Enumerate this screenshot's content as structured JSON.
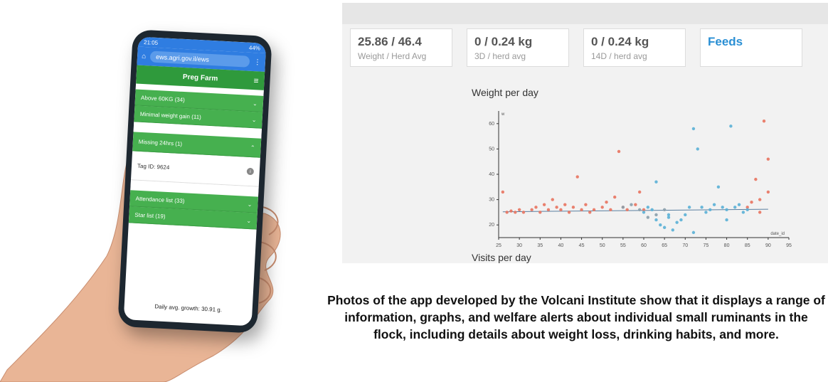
{
  "phone": {
    "status_time": "21:05",
    "status_right": "44%",
    "url": "ews.agri.gov.il/ews",
    "app_title": "Preg Farm",
    "sections": [
      {
        "label": "Above 60KG (34)"
      },
      {
        "label": "Minimal weight gain (11)"
      },
      {
        "label": "Missing 24hrs  (1)"
      },
      {
        "label": "Attendance list (33)"
      },
      {
        "label": "Star list  (19)"
      }
    ],
    "tag_id": "Tag ID: 9624",
    "footer": "Daily avg. growth: 30.91 g."
  },
  "dashboard": {
    "cards": [
      {
        "value": "25.86 / 46.4",
        "label": "Weight / Herd Avg"
      },
      {
        "value": "0 / 0.24 kg",
        "label": "3D / herd avg"
      },
      {
        "value": "0 / 0.24 kg",
        "label": "14D / herd avg"
      },
      {
        "value": "Feeds",
        "label": ""
      }
    ],
    "chart_title": "Weight per day",
    "visits_label": "Visits per day"
  },
  "chart_data": {
    "type": "scatter",
    "xlabel": "date_id",
    "ylabel": "w",
    "xlim": [
      25,
      95
    ],
    "ylim": [
      15,
      65
    ],
    "xticks": [
      25,
      30,
      35,
      40,
      45,
      50,
      55,
      60,
      65,
      70,
      75,
      80,
      85,
      90,
      95
    ],
    "yticks": [
      20,
      30,
      40,
      50,
      60
    ],
    "series": [
      {
        "color": "#e8735f",
        "points": [
          [
            26,
            33
          ],
          [
            27,
            25
          ],
          [
            28,
            25.5
          ],
          [
            29,
            25
          ],
          [
            30,
            26
          ],
          [
            31,
            25
          ],
          [
            33,
            26
          ],
          [
            34,
            27
          ],
          [
            35,
            25
          ],
          [
            36,
            28
          ],
          [
            37,
            26
          ],
          [
            38,
            30
          ],
          [
            39,
            27
          ],
          [
            40,
            26
          ],
          [
            41,
            28
          ],
          [
            42,
            25
          ],
          [
            43,
            27
          ],
          [
            44,
            39
          ],
          [
            45,
            26
          ],
          [
            46,
            28
          ],
          [
            47,
            25
          ],
          [
            48,
            26
          ],
          [
            50,
            27
          ],
          [
            51,
            29
          ],
          [
            52,
            26
          ],
          [
            53,
            31
          ],
          [
            54,
            49
          ],
          [
            55,
            27
          ],
          [
            56,
            26
          ],
          [
            58,
            28
          ],
          [
            59,
            33
          ],
          [
            60,
            26
          ],
          [
            85,
            27
          ],
          [
            86,
            29
          ],
          [
            87,
            38
          ],
          [
            88,
            30
          ],
          [
            89,
            61
          ],
          [
            90,
            46
          ],
          [
            90,
            33
          ],
          [
            88,
            25
          ]
        ]
      },
      {
        "color": "#5ab0d6",
        "points": [
          [
            60,
            25
          ],
          [
            61,
            27
          ],
          [
            62,
            26
          ],
          [
            63,
            22
          ],
          [
            64,
            20
          ],
          [
            65,
            19
          ],
          [
            66,
            24
          ],
          [
            67,
            18
          ],
          [
            68,
            21
          ],
          [
            69,
            22
          ],
          [
            70,
            24
          ],
          [
            71,
            27
          ],
          [
            72,
            58
          ],
          [
            73,
            50
          ],
          [
            74,
            27
          ],
          [
            75,
            25
          ],
          [
            76,
            26
          ],
          [
            77,
            28
          ],
          [
            78,
            35
          ],
          [
            79,
            27
          ],
          [
            80,
            26
          ],
          [
            81,
            59
          ],
          [
            82,
            27
          ],
          [
            83,
            28
          ],
          [
            84,
            25
          ],
          [
            85,
            26
          ],
          [
            63,
            37
          ],
          [
            66,
            23
          ],
          [
            72,
            17
          ],
          [
            80,
            22
          ]
        ]
      },
      {
        "color": "#8a9fab",
        "points": [
          [
            55,
            27
          ],
          [
            57,
            28
          ],
          [
            59,
            26
          ],
          [
            61,
            23
          ],
          [
            63,
            24
          ],
          [
            65,
            26
          ]
        ]
      }
    ]
  },
  "caption": "Photos of the app developed by the Volcani Institute show that it displays a range of information, graphs, and welfare alerts about individual small ruminants in the flock, including details about weight loss, drinking habits, and more."
}
